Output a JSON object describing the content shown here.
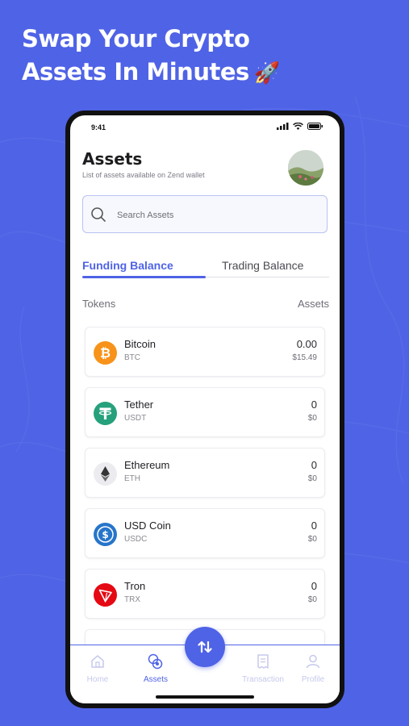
{
  "headline": {
    "line1": "Swap Your Crypto",
    "line2": "Assets In Minutes",
    "emoji": "🚀"
  },
  "status_bar": {
    "time": "9:41"
  },
  "header": {
    "title": "Assets",
    "subtitle": "List of assets available on Zend wallet"
  },
  "search": {
    "placeholder": "Search Assets",
    "value": ""
  },
  "tabs": [
    {
      "label": "Funding Balance",
      "active": true
    },
    {
      "label": "Trading Balance",
      "active": false
    }
  ],
  "columns": {
    "tokens": "Tokens",
    "assets": "Assets"
  },
  "tokens": [
    {
      "name": "Bitcoin",
      "symbol": "BTC",
      "amount": "0.00",
      "value": "$15.49",
      "icon": "bitcoin-icon",
      "color": "#f7931a"
    },
    {
      "name": "Tether",
      "symbol": "USDT",
      "amount": "0",
      "value": "$0",
      "icon": "tether-icon",
      "color": "#26a17b"
    },
    {
      "name": "Ethereum",
      "symbol": "ETH",
      "amount": "0",
      "value": "$0",
      "icon": "ethereum-icon",
      "color": "#ececf0"
    },
    {
      "name": "USD Coin",
      "symbol": "USDC",
      "amount": "0",
      "value": "$0",
      "icon": "usd-coin-icon",
      "color": "#2775ca"
    },
    {
      "name": "Tron",
      "symbol": "TRX",
      "amount": "0",
      "value": "$0",
      "icon": "tron-icon",
      "color": "#e50914"
    }
  ],
  "bottom_nav": {
    "home": "Home",
    "assets": "Assets",
    "transaction": "Transaction",
    "profile": "Profile"
  },
  "colors": {
    "brand": "#4f63e6",
    "inactive_nav": "#c6c9ec"
  }
}
